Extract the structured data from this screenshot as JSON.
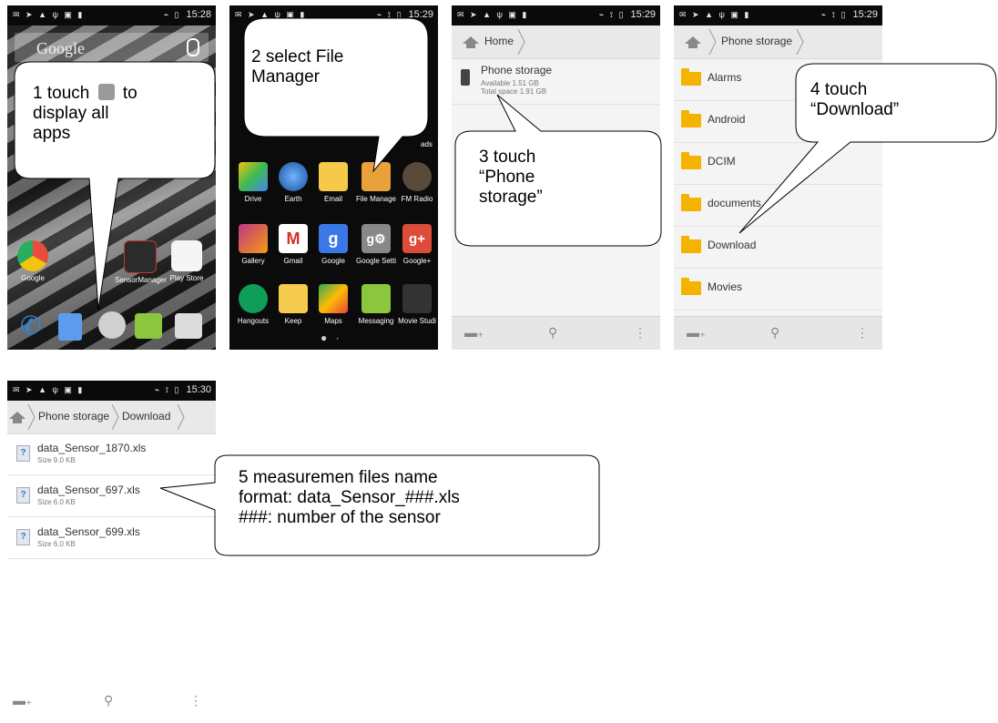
{
  "screens": [
    {
      "time": "15:28"
    },
    {
      "time": "15:29"
    },
    {
      "time": "15:29"
    },
    {
      "time": "15:29"
    },
    {
      "time": "15:30"
    }
  ],
  "home": {
    "search_label": "Google",
    "apps": [
      "Google",
      "SensorManager",
      "Play Store"
    ]
  },
  "drawer": {
    "truncated_label": "ads",
    "row1": [
      "Drive",
      "Earth",
      "Email",
      "File Manage",
      "FM Radio"
    ],
    "row2": [
      "Gallery",
      "Gmail",
      "Google",
      "Google Setti",
      "Google+"
    ],
    "row3": [
      "Hangouts",
      "Keep",
      "Maps",
      "Messaging",
      "Movie Studi"
    ],
    "row2_glyphs": [
      "",
      "M",
      "g",
      "g⚙",
      "g+"
    ]
  },
  "storage": {
    "home_crumb": "Home",
    "name": "Phone storage",
    "available": "Available 1.51 GB",
    "total": "Total space 1.91 GB"
  },
  "folders": {
    "crumb": "Phone storage",
    "items": [
      "Alarms",
      "Android",
      "DCIM",
      "documents",
      "Download",
      "Movies"
    ]
  },
  "files": {
    "crumb1": "Phone storage",
    "crumb2": "Download",
    "items": [
      {
        "name": "data_Sensor_1870.xls",
        "size": "Size 9.0 KB"
      },
      {
        "name": "data_Sensor_697.xls",
        "size": "Size 6.0 KB"
      },
      {
        "name": "data_Sensor_699.xls",
        "size": "Size 6.0 KB"
      }
    ]
  },
  "callouts": {
    "c1_a": "1 touch",
    "c1_b": "to",
    "c1_c": "display all",
    "c1_d": "apps",
    "c2_a": "2 select File",
    "c2_b": "Manager",
    "c3_a": "3 touch",
    "c3_b": "“Phone",
    "c3_c": "storage”",
    "c4_a": "4 touch",
    "c4_b": "“Download”",
    "c5_a": "5 measuremen files name",
    "c5_b": "format: data_Sensor_###.xls",
    "c5_c": "###: number of the sensor"
  },
  "colors": {
    "folder": "#f3b300",
    "bubble_border": "#000000"
  }
}
